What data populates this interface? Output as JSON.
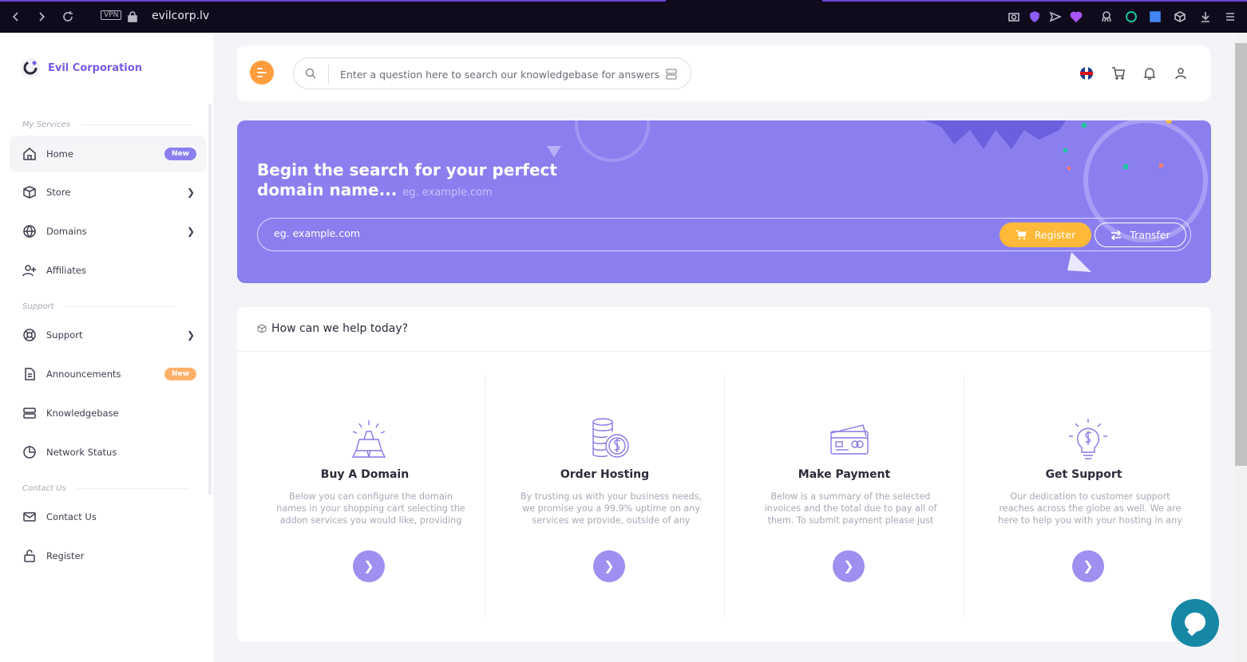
{
  "browser": {
    "vpn_label": "VPN",
    "url": "evilcorp.lv"
  },
  "brand": {
    "name": "Evil Corporation",
    "accent": "#7a5ce6"
  },
  "sidebar": {
    "sections": {
      "my_services": "My Services",
      "support": "Support",
      "contact_us": "Contact Us"
    },
    "items": [
      {
        "label": "Home",
        "icon": "home-icon",
        "badge": "New",
        "badge_color": "#8b7ff0"
      },
      {
        "label": "Store",
        "icon": "box-icon",
        "chevron": true
      },
      {
        "label": "Domains",
        "icon": "globe-icon",
        "chevron": true
      },
      {
        "label": "Affiliates",
        "icon": "user-plus-icon"
      },
      {
        "label": "Support",
        "icon": "lifebuoy-icon",
        "chevron": true
      },
      {
        "label": "Announcements",
        "icon": "document-icon",
        "badge": "New",
        "badge_color": "#ffb16b"
      },
      {
        "label": "Knowledgebase",
        "icon": "server-icon"
      },
      {
        "label": "Network Status",
        "icon": "pie-chart-icon"
      },
      {
        "label": "Contact Us",
        "icon": "mail-icon"
      },
      {
        "label": "Register",
        "icon": "unlock-icon"
      }
    ]
  },
  "header": {
    "search_placeholder": "Enter a question here to search our knowledgebase for answers..."
  },
  "hero": {
    "title": "Begin the search for your perfect domain name...",
    "hint": "eg. example.com",
    "input_placeholder": "eg. example.com",
    "register_label": "Register",
    "transfer_label": "Transfer",
    "colors": {
      "background": "#8b7ff0",
      "register": "#ffb938"
    }
  },
  "help": {
    "title": "How can we help today?",
    "cards": [
      {
        "title": "Buy A Domain",
        "icon": "gold-bars-icon",
        "text": "Below you can configure the domain names in your shopping cart selecting the addon services you would like, providing required ..."
      },
      {
        "title": "Order Hosting",
        "icon": "coins-icon",
        "text": "By trusting us with your business needs, we promise you a 99.9% uptime on any services we provide, outside of any standard ..."
      },
      {
        "title": "Make Payment",
        "icon": "credit-card-icon",
        "text": "Below is a summary of the selected invoices and the total due to pay all of them. To submit payment please just choose your ..."
      },
      {
        "title": "Get Support",
        "icon": "lightbulb-icon",
        "text": "Our dedication to customer support reaches across the globe as well. We are here to help you with your hosting in any way possible, ..."
      }
    ]
  },
  "chat": {
    "icon": "chat-bubble-icon",
    "color": "#1688a6"
  }
}
